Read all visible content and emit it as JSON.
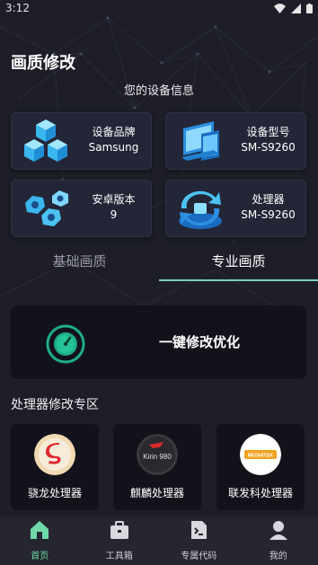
{
  "status_bar": {
    "time": "3:12"
  },
  "page_title": "画质修改",
  "device_info": {
    "heading": "您的设备信息",
    "cards": [
      {
        "label": "设备品牌",
        "value": "Samsung",
        "icon": "cubes-icon"
      },
      {
        "label": "设备型号",
        "value": "SM-S9260",
        "icon": "devices-icon"
      },
      {
        "label": "安卓版本",
        "value": "9",
        "icon": "gear-nuts-icon"
      },
      {
        "label": "处理器",
        "value": "SM-S9260",
        "icon": "refresh-chip-icon"
      }
    ]
  },
  "tabs": [
    {
      "label": "基础画质",
      "active": false
    },
    {
      "label": "专业画质",
      "active": true
    }
  ],
  "optimize": {
    "label": "一键修改优化",
    "icon": "timer-icon"
  },
  "processor_zone": {
    "title": "处理器修改专区",
    "items": [
      {
        "label": "骁龙处理器",
        "logo": "snapdragon-logo"
      },
      {
        "label": "麒麟处理器",
        "logo": "kirin-logo",
        "logo_text": "Kirin 980"
      },
      {
        "label": "联发科处理器",
        "logo": "mediatek-logo",
        "logo_text": "MEDIATEK"
      }
    ]
  },
  "bottom_nav": [
    {
      "label": "首页",
      "icon": "home-icon",
      "active": true
    },
    {
      "label": "工具箱",
      "icon": "toolbox-icon",
      "active": false
    },
    {
      "label": "专属代码",
      "icon": "code-file-icon",
      "active": false
    },
    {
      "label": "我的",
      "icon": "profile-icon",
      "active": false
    }
  ],
  "colors": {
    "accent": "#6fd9a7",
    "tab_underline": "#7bcfbf",
    "background": "#1d1e28"
  }
}
